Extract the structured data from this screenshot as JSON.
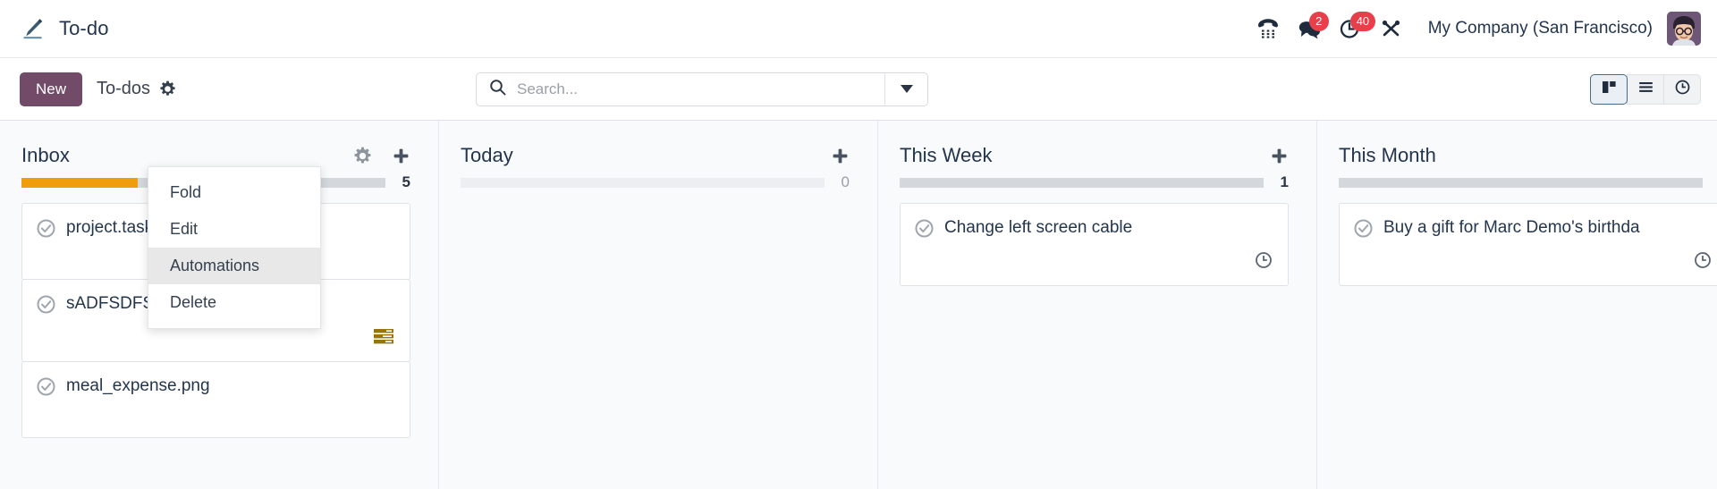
{
  "navbar": {
    "app_title": "To-do",
    "app_icon": "pencil-icon",
    "icons": [
      {
        "name": "voip-dialpad-icon",
        "badge": null
      },
      {
        "name": "messaging-chat-icon",
        "badge": "2"
      },
      {
        "name": "activities-clock-icon",
        "badge": "40"
      },
      {
        "name": "developer-tools-icon",
        "badge": null
      }
    ],
    "company": "My Company (San Francisco)",
    "avatar": "user-avatar"
  },
  "control_panel": {
    "new_label": "New",
    "breadcrumb": "To-dos",
    "settings_icon": "gear-icon",
    "search": {
      "placeholder": "Search...",
      "value": "",
      "icon": "search-icon",
      "toggle_icon": "chevron-down-icon"
    },
    "views": [
      {
        "name": "kanban-view",
        "icon": "kanban-icon",
        "active": true
      },
      {
        "name": "list-view",
        "icon": "list-icon",
        "active": false
      },
      {
        "name": "activity-view",
        "icon": "clock-icon",
        "active": false
      }
    ]
  },
  "kanban": {
    "columns": [
      {
        "title": "Inbox",
        "count": "5",
        "has_gear": true,
        "has_plus": true,
        "progress": [
          {
            "color": "#ef9d0d",
            "width": "32%"
          },
          {
            "color": "#d4d7dc",
            "width": "68%"
          }
        ],
        "cards": [
          {
            "title": "project.task,l",
            "footer_icon": null
          },
          {
            "title": "sADFSDFSDF",
            "footer_icon": "bars-list-icon",
            "footer_color": "#9a7408"
          },
          {
            "title": "meal_expense.png",
            "footer_icon": null
          }
        ]
      },
      {
        "title": "Today",
        "count": "0",
        "has_gear": false,
        "has_plus": true,
        "progress": [
          {
            "color": "#eceef1",
            "width": "100%"
          }
        ],
        "cards": []
      },
      {
        "title": "This Week",
        "count": "1",
        "has_gear": false,
        "has_plus": true,
        "progress": [
          {
            "color": "#d4d7dc",
            "width": "100%"
          }
        ],
        "cards": [
          {
            "title": "Change left screen cable",
            "footer_icon": "clock-icon",
            "footer_color": "#5a6472"
          }
        ]
      },
      {
        "title": "This Month",
        "count": "",
        "has_gear": false,
        "has_plus": false,
        "progress": [
          {
            "color": "#d4d7dc",
            "width": "100%"
          }
        ],
        "cards": [
          {
            "title": "Buy a gift for Marc Demo's birthda",
            "footer_icon": "clock-icon",
            "footer_color": "#5a6472"
          }
        ]
      }
    ]
  },
  "dropdown": {
    "items": [
      {
        "label": "Fold",
        "active": false
      },
      {
        "label": "Edit",
        "active": false
      },
      {
        "label": "Automations",
        "active": true
      },
      {
        "label": "Delete",
        "active": false
      }
    ]
  },
  "colors": {
    "brand_purple": "#714b67",
    "badge_red": "#e7404a",
    "progress_orange": "#ef9d0d",
    "accent_blue": "#4a6a85"
  }
}
